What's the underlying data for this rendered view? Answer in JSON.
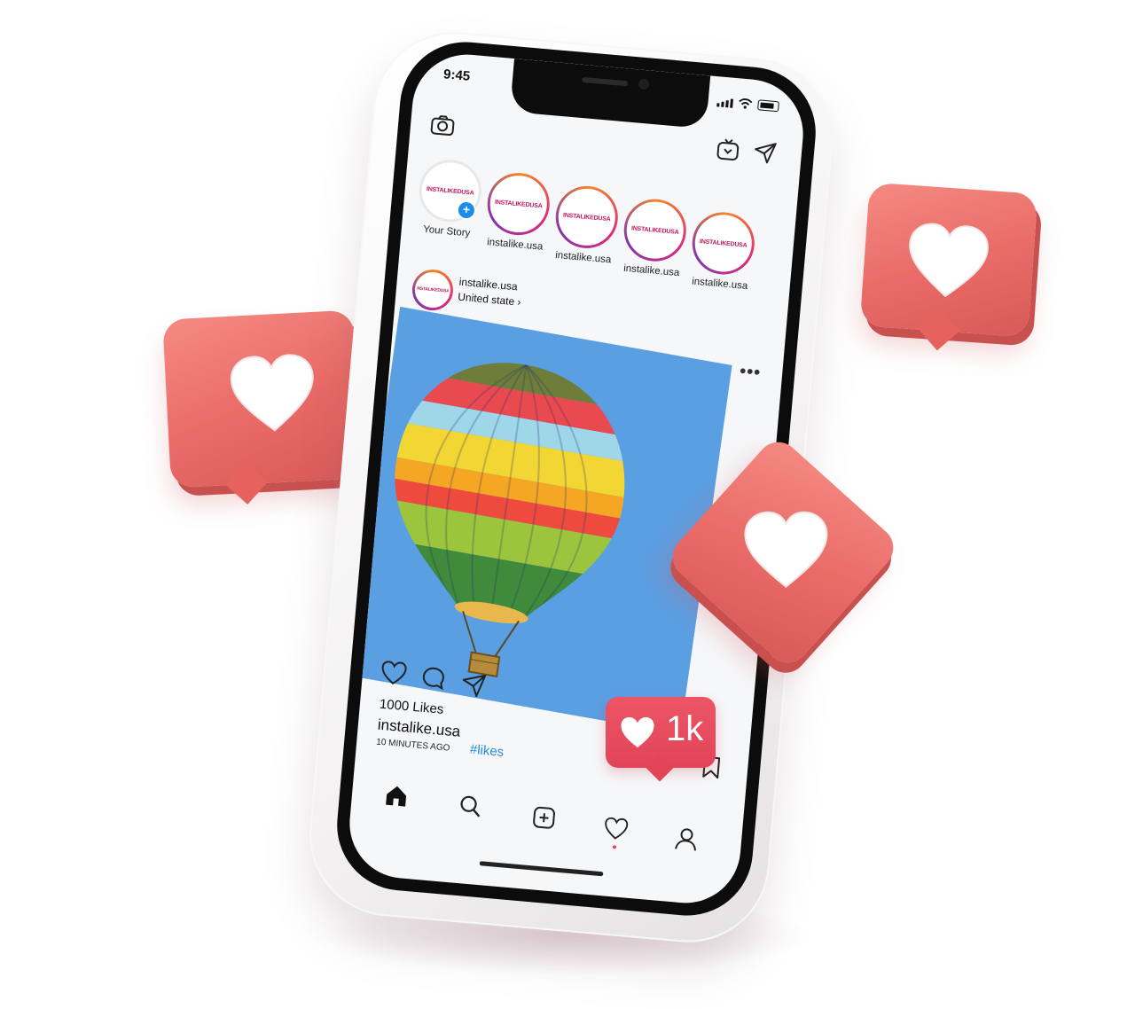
{
  "status_bar": {
    "time": "9:45"
  },
  "stories": [
    {
      "label": "Your Story",
      "avatar_text": "INSTALIKEDUSA",
      "own": true
    },
    {
      "label": "instalike.usa",
      "avatar_text": "INSTALIKEDUSA"
    },
    {
      "label": "instalike.usa",
      "avatar_text": "INSTALIKEDUSA"
    },
    {
      "label": "instalike.usa",
      "avatar_text": "INSTALIKEDUSA"
    },
    {
      "label": "instalike.usa",
      "avatar_text": "INSTALIKEDUSA"
    }
  ],
  "post": {
    "username": "instalike.usa",
    "location": "United state",
    "location_chevron": "›",
    "more": "•••",
    "image_subject": "hot-air-balloon",
    "likes": "1000 Likes",
    "caption_user": "instalike.usa",
    "hashtag": "#likes",
    "time_ago": "10 MINUTES AGO"
  },
  "like_badge": {
    "count": "1k"
  },
  "icons": {
    "top": [
      "camera-icon",
      "igtv-icon",
      "send-icon"
    ],
    "actions": [
      "heart-icon",
      "comment-icon",
      "share-icon",
      "bookmark-icon"
    ],
    "nav": [
      "home-icon",
      "search-icon",
      "add-post-icon",
      "activity-heart-icon",
      "profile-icon"
    ]
  },
  "colors": {
    "bubble": "#ea6c67",
    "badge": "#e64a5c",
    "post_background": "#5b9fe3",
    "hashtag": "#1f8fe0",
    "story_ring": "#dd2a7b"
  }
}
